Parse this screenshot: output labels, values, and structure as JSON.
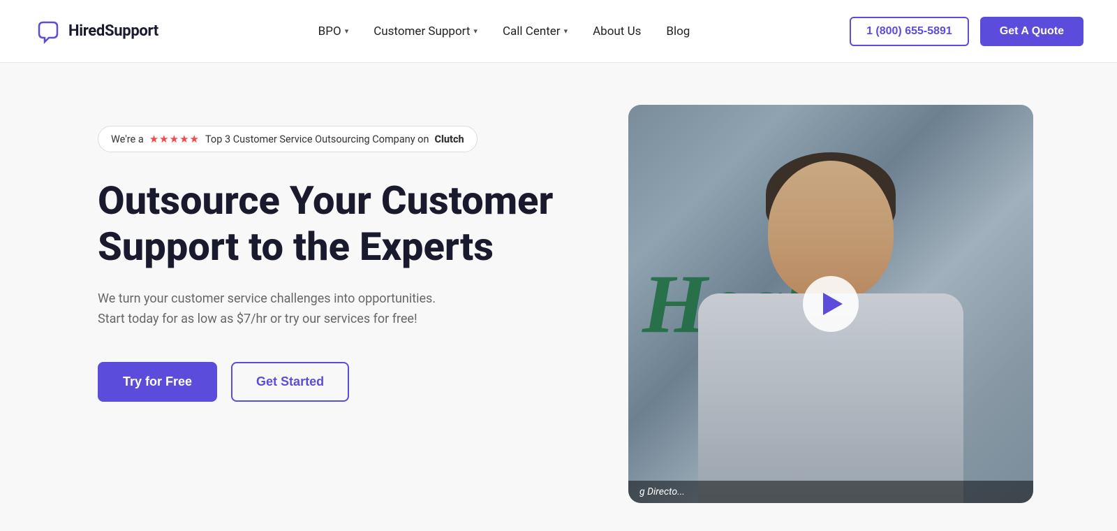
{
  "brand": {
    "name": "HiredSupport",
    "logo_alt": "HiredSupport logo"
  },
  "navbar": {
    "nav_items": [
      {
        "label": "BPO",
        "has_dropdown": true
      },
      {
        "label": "Customer Support",
        "has_dropdown": true
      },
      {
        "label": "Call Center",
        "has_dropdown": true
      },
      {
        "label": "About Us",
        "has_dropdown": false
      },
      {
        "label": "Blog",
        "has_dropdown": false
      }
    ],
    "phone_label": "1 (800) 655-5891",
    "quote_label": "Get A Quote"
  },
  "hero": {
    "badge_text_pre": "We're a",
    "badge_stars": "★★★★★",
    "badge_text_post": "Top 3 Customer Service Outsourcing Company on",
    "badge_brand": "Clutch",
    "title": "Outsource Your Customer Support to the Experts",
    "subtitle": "We turn your customer service challenges into opportunities. Start today for as low as $7/hr or try our services for free!",
    "try_free_label": "Try for Free",
    "get_started_label": "Get Started",
    "video_text": "Healt",
    "video_bottom_label": "g Directo..."
  }
}
